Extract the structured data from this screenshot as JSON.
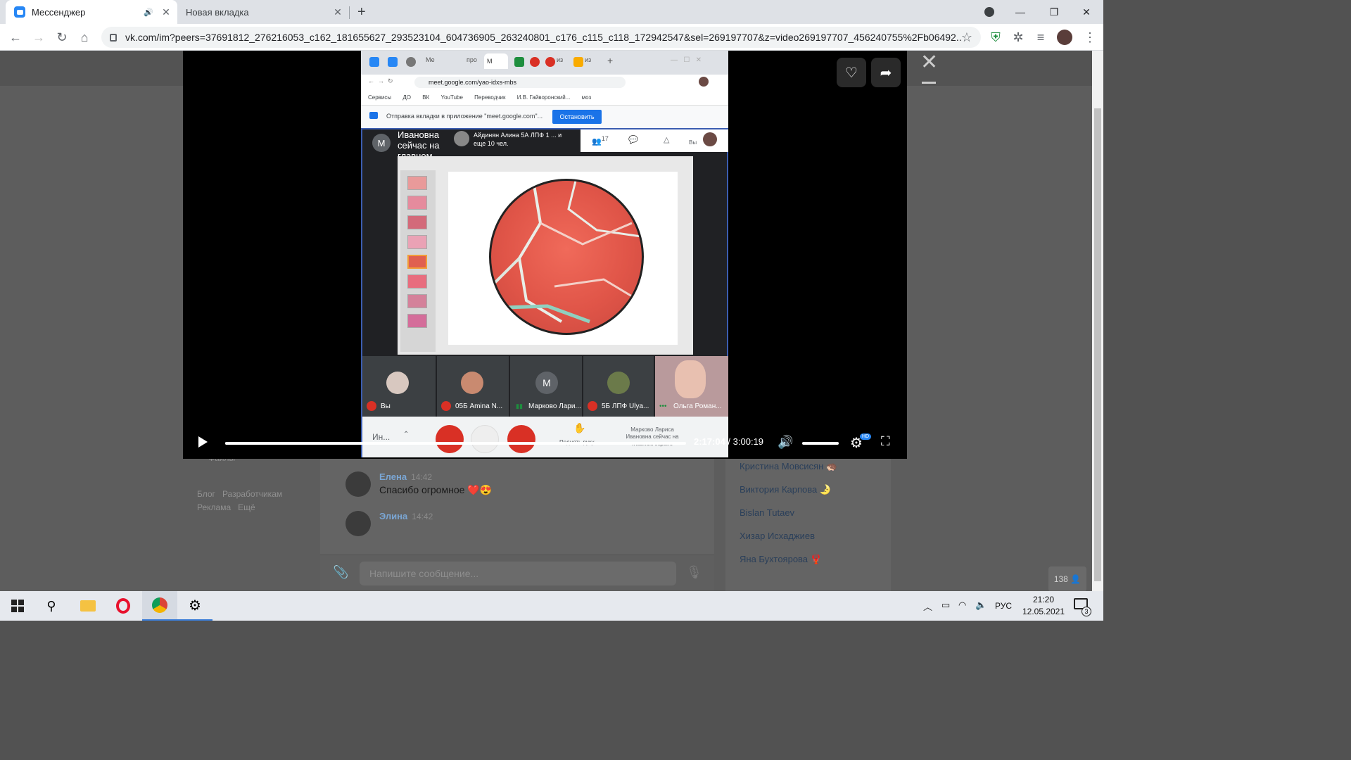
{
  "browser": {
    "tabs": [
      {
        "title": "Мессенджер",
        "active": true
      },
      {
        "title": "Новая вкладка",
        "active": false
      }
    ],
    "url": "vk.com/im?peers=37691812_276216053_c162_181655627_293523104_604736905_263240801_c176_c115_c118_172942547&sel=269197707&z=video269197707_456240755%2Fb06492..."
  },
  "inner_browser": {
    "tabs": [
      "Ме",
      "про",
      "М",
      "из",
      "из"
    ],
    "url": "meet.google.com/yao-idxs-mbs",
    "bookmarks": [
      "Сервисы",
      "ДО",
      "ВК",
      "YouTube",
      "Переводчик",
      "И.В. Гайворонский...",
      "моз"
    ],
    "cast_text": "Отправка вкладки в приложение \"meet.google.com\"...",
    "cast_button": "Остановить"
  },
  "meet": {
    "presenter_avatar": "M",
    "presenter_text": "Ивановна сейчас на главном экране",
    "participants_label": "Айдинян Алина 5А ЛПФ 1 ... и еще 10 чел.",
    "people_count": "17",
    "you_label": "Вы",
    "tiles": [
      {
        "label": "Вы",
        "muted": true
      },
      {
        "label": "05Б Amina N...",
        "muted": true
      },
      {
        "label": "Марково Лари...",
        "muted": false,
        "initial": "M"
      },
      {
        "label": "5Б ЛПФ Ulya...",
        "muted": true
      },
      {
        "label": "Ольга Роман...",
        "muted": false
      }
    ],
    "bottom_left": "Ин...",
    "raise_hand": "Поднять руку",
    "present_text": "Марково Лариса Ивановна сейчас на главном экране"
  },
  "player": {
    "current_time": "2:17:04",
    "total_time": "3:00:19",
    "hd_badge": "HD",
    "progress": 0.76
  },
  "vk": {
    "left_links": [
      "Файлы",
      "Блог",
      "Разработчикам",
      "Реклама",
      "Ещё"
    ],
    "messages": [
      {
        "name": "Елена",
        "time": "14:42",
        "text": "Спасибо огромное ❤️😍"
      },
      {
        "name": "Элина",
        "time": "14:42",
        "text": ""
      }
    ],
    "composer_placeholder": "Напишите сообщение...",
    "members": [
      "Кристина Мовсисян 🦔",
      "Виктория Карпова 🌛",
      "Bislan Tutaev",
      "Хизар Исхаджиев",
      "Яна Бухтоярова 🦞"
    ],
    "members_count": "138"
  },
  "taskbar": {
    "lang": "РУС",
    "time": "21:20",
    "date": "12.05.2021",
    "notifications": "3"
  }
}
